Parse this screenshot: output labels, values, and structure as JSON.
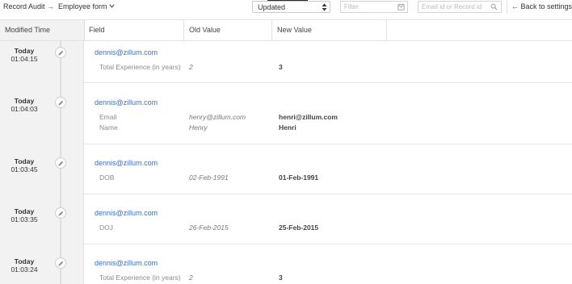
{
  "breadcrumb": {
    "root": "Record Audit",
    "arrow": "→",
    "current": "Employee form"
  },
  "toolbar": {
    "action_select_value": "Updated",
    "filter_placeholder": "Filter",
    "search_placeholder": "Email id or Record id",
    "back_label": "← Back to settings"
  },
  "table": {
    "columns": [
      "Modified Time",
      "Field",
      "Old Value",
      "New Value",
      ""
    ]
  },
  "entries": [
    {
      "day": "Today",
      "time": "01:04:15",
      "user": "dennis@zillum.com",
      "changes": [
        {
          "field": "Total Experience (in years)",
          "old": "2",
          "new": "3"
        }
      ]
    },
    {
      "day": "Today",
      "time": "01:04:03",
      "user": "dennis@zillum.com",
      "changes": [
        {
          "field": "Email",
          "old": "henry@zillum.com",
          "new": "henri@zillum.com"
        },
        {
          "field": "Name",
          "old": "Henry",
          "new": "Henri"
        }
      ]
    },
    {
      "day": "Today",
      "time": "01:03:45",
      "user": "dennis@zillum.com",
      "changes": [
        {
          "field": "DOB",
          "old": "02-Feb-1991",
          "new": "01-Feb-1991"
        }
      ]
    },
    {
      "day": "Today",
      "time": "01:03:35",
      "user": "dennis@zillum.com",
      "changes": [
        {
          "field": "DOJ",
          "old": "26-Feb-2015",
          "new": "25-Feb-2015"
        }
      ]
    },
    {
      "day": "Today",
      "time": "01:03:24",
      "user": "dennis@zillum.com",
      "changes": [
        {
          "field": "Total Experience (in years)",
          "old": "2",
          "new": "3"
        }
      ]
    }
  ],
  "colors": {
    "link": "#3a6fc0",
    "left_column_bg": "#f2f2f2"
  },
  "icons": {
    "breadcrumb_chevron": "chevron-down-icon",
    "select_arrows": "up-down-arrows-icon",
    "filter_calendar": "calendar-icon",
    "search": "search-icon",
    "entry_edit": "pencil-icon"
  }
}
